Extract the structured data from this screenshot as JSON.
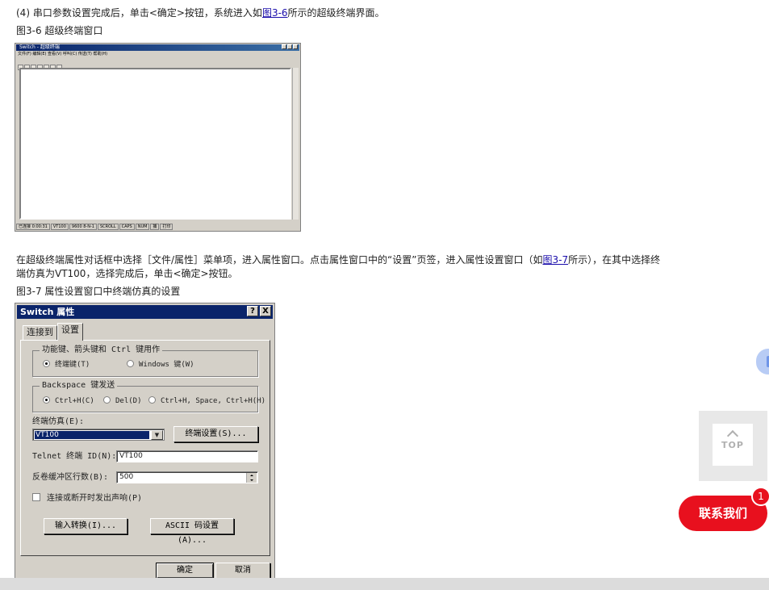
{
  "article": {
    "step4_prefix": "(4)  串口参数设置完成后，单击<确定>按钮，系统进入如",
    "step4_link": "图3-6",
    "step4_suffix": "所示的超级终端界面。",
    "fig36_caption": "图3-6 超级终端窗口",
    "para2_line1_prefix": "在超级终端属性对话框中选择［文件/属性］菜单项，进入属性窗口。点击属性窗口中的“设置”页签，进入属性设置窗口（如",
    "para2_line1_link": "图3-7",
    "para2_line1_suffix": "所示），在其中选择终",
    "para2_line2": "端仿真为VT100，选择完成后，单击<确定>按钮。",
    "fig37_caption": "图3-7 属性设置窗口中终端仿真的设置"
  },
  "terminal_window": {
    "title": "Switch - 超级终端",
    "menu": "文件(F)  编辑(E)  查看(V)  呼叫(C)  传送(T)  帮助(H)",
    "status_items": [
      "已连接 0:00:31",
      "VT100",
      "9600 8-N-1",
      "SCROLL",
      "CAPS",
      "NUM",
      "捕",
      "打印"
    ]
  },
  "dialog": {
    "title": "Switch 属性",
    "help_btn": "?",
    "close_btn": "X",
    "tabs": [
      "连接到",
      "设置"
    ],
    "group_keys": {
      "label": "功能键、箭头键和 Ctrl 键用作",
      "options": [
        "终端键(T)",
        "Windows 键(W)"
      ]
    },
    "group_backspace": {
      "label": "Backspace 键发送",
      "options": [
        "Ctrl+H(C)",
        "Del(D)",
        "Ctrl+H, Space, Ctrl+H(H)"
      ]
    },
    "emulation_label": "终端仿真(E):",
    "emulation_value": "VT100",
    "terminal_settings_btn": "终端设置(S)...",
    "telnet_label": "Telnet 终端 ID(N):",
    "telnet_value": "VT100",
    "backscroll_label": "反卷缓冲区行数(B):",
    "backscroll_value": "500",
    "beep_label": "连接或断开时发出声响(P)",
    "input_translation_btn": "输入转换(I)...",
    "ascii_setup_btn": "ASCII 码设置(A)...",
    "ok_btn": "确定",
    "cancel_btn": "取消"
  },
  "widgets": {
    "top_label": "TOP",
    "contact_label": "联系我们",
    "badge_count": "1"
  }
}
